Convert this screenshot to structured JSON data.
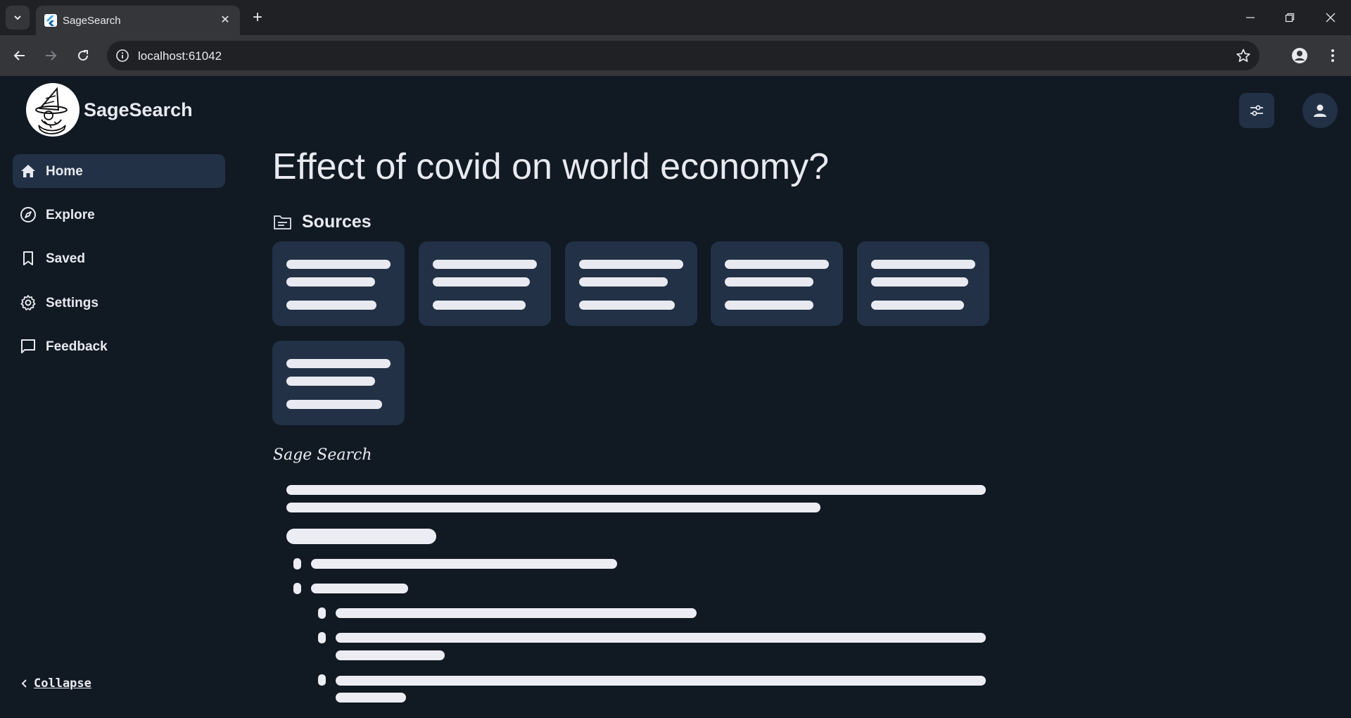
{
  "browser": {
    "tab_title": "SageSearch",
    "url": "localhost:61042"
  },
  "app": {
    "brand": "SageSearch"
  },
  "sidebar": {
    "items": [
      {
        "label": "Home",
        "icon": "home-icon",
        "active": true
      },
      {
        "label": "Explore",
        "icon": "compass-icon",
        "active": false
      },
      {
        "label": "Saved",
        "icon": "bookmark-icon",
        "active": false
      },
      {
        "label": "Settings",
        "icon": "gear-icon",
        "active": false
      },
      {
        "label": "Feedback",
        "icon": "chat-icon",
        "active": false
      }
    ],
    "collapse_label": "Collapse"
  },
  "main": {
    "query_title": "Effect of covid on world economy?",
    "sources_label": "Sources",
    "answer_label": "Sage Search"
  },
  "colors": {
    "background": "#111923",
    "card": "#223146",
    "skeleton": "#e9eaf1"
  }
}
